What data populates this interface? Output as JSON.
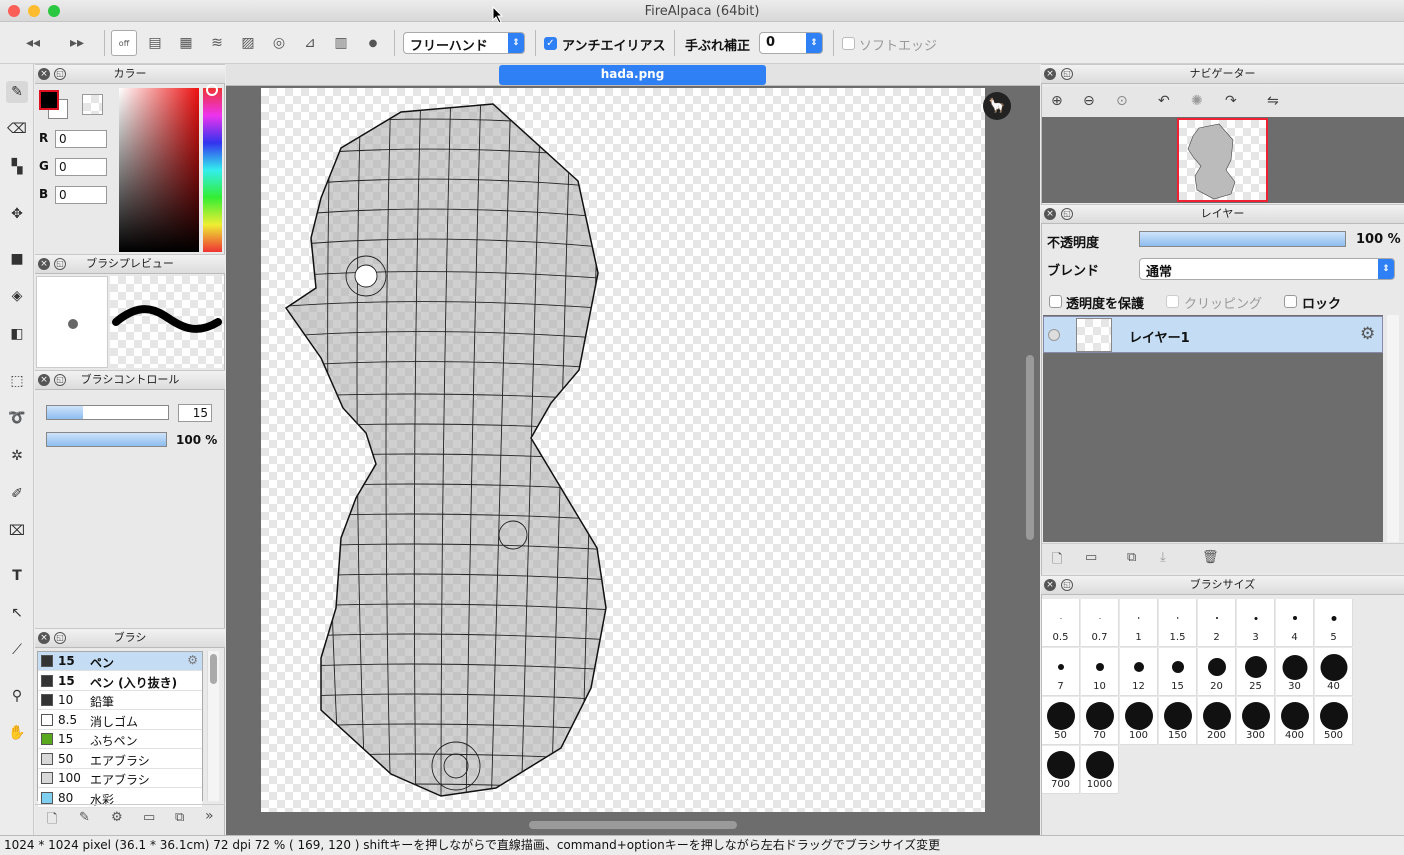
{
  "window": {
    "title": "FireAlpaca (64bit)"
  },
  "toolbar": {
    "snap_off_label": "off",
    "mode_select": "フリーハンド",
    "antialias_label": "アンチエイリアス",
    "stabilizer_label": "手ぶれ補正",
    "stabilizer_value": "0",
    "soft_edge_label": "ソフトエッジ"
  },
  "color_panel": {
    "title": "カラー",
    "r_label": "R",
    "g_label": "G",
    "b_label": "B",
    "r": "0",
    "g": "0",
    "b": "0"
  },
  "brush_preview": {
    "title": "ブラシプレビュー"
  },
  "brush_control": {
    "title": "ブラシコントロール",
    "size_value": "15",
    "size_fraction": 0.3,
    "opacity_value": "100 %"
  },
  "brush_panel": {
    "title": "ブラシ",
    "items": [
      {
        "size": "15",
        "name": "ペン",
        "color": "#333333"
      },
      {
        "size": "15",
        "name": "ペン (入り抜き)",
        "color": "#333333"
      },
      {
        "size": "10",
        "name": "鉛筆",
        "color": "#333333"
      },
      {
        "size": "8.5",
        "name": "消しゴム",
        "color": "#ffffff"
      },
      {
        "size": "15",
        "name": "ふちペン",
        "color": "#5aa81e"
      },
      {
        "size": "50",
        "name": "エアブラシ",
        "color": "#d8d8d8"
      },
      {
        "size": "100",
        "name": "エアブラシ",
        "color": "#d8d8d8"
      },
      {
        "size": "80",
        "name": "水彩",
        "color": "#7fd0f0"
      }
    ]
  },
  "canvas": {
    "tab": "hada.png"
  },
  "navigator": {
    "title": "ナビゲーター"
  },
  "layer_panel": {
    "title": "レイヤー",
    "opacity_label": "不透明度",
    "opacity_value": "100 %",
    "blend_label": "ブレンド",
    "blend_value": "通常",
    "protect_label": "透明度を保護",
    "clipping_label": "クリッピング",
    "lock_label": "ロック",
    "layer_name": "レイヤー1"
  },
  "brush_size_panel": {
    "title": "ブラシサイズ",
    "sizes": [
      "0.5",
      "0.7",
      "1",
      "1.5",
      "2",
      "3",
      "4",
      "5",
      "7",
      "10",
      "12",
      "15",
      "20",
      "25",
      "30",
      "40",
      "50",
      "70",
      "100",
      "150",
      "200",
      "300",
      "400",
      "500",
      "700",
      "1000"
    ]
  },
  "status": {
    "text": "1024 * 1024 pixel   (36.1 * 36.1cm)   72 dpi   72 %   ( 169, 120 )   shiftキーを押しながらで直線描画、command+optionキーを押しながら左右ドラッグでブラシサイズ変更"
  }
}
